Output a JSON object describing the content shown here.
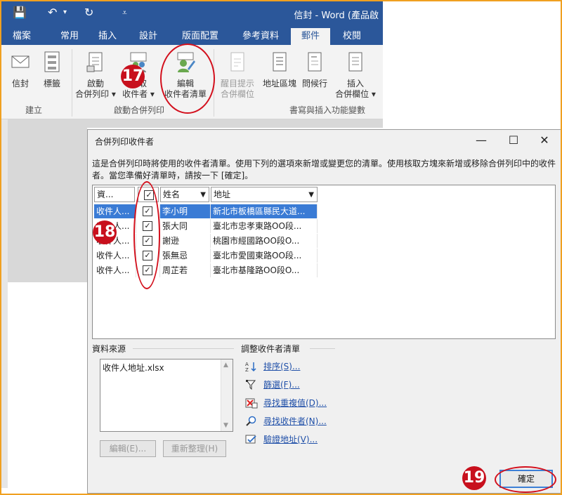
{
  "app": {
    "title": "信封 - Word (產品啟",
    "quick_access": {
      "save": "💾",
      "undo": "↶",
      "redo": "↻",
      "customize": "⩡"
    },
    "tabs": [
      "檔案",
      "常用",
      "插入",
      "設計",
      "版面配置",
      "參考資料",
      "郵件",
      "校閱"
    ],
    "active_tab": "郵件"
  },
  "ribbon": {
    "create": {
      "envelope": "信封",
      "labels": "標籤",
      "group": "建立"
    },
    "start": {
      "start_merge": [
        "啟動",
        "合併列印 ▾"
      ],
      "select_recipients": [
        "選取",
        "收件者 ▾"
      ],
      "edit_recipients": [
        "編輯",
        "收件者清單"
      ],
      "group": "啟動合併列印"
    },
    "write": {
      "highlight_fields": [
        "醒目提示",
        "合併欄位"
      ],
      "address_block": "地址區塊",
      "greeting_line": "問候行",
      "insert_field": [
        "插入",
        "合併欄位 ▾"
      ],
      "group": "書寫與插入功能變數"
    }
  },
  "dialog": {
    "title": "合併列印收件者",
    "controls": {
      "minimize": "—",
      "maximize": "☐",
      "close": "✕"
    },
    "instructions": "這是合併列印時將使用的收件者清單。使用下列的選項來新增或變更您的清單。使用核取方塊來新增或移除合併列印中的收件者。當您準備好清單時，請按一下 [確定]。",
    "columns": {
      "source": "資...",
      "check": "✓",
      "name": "姓名",
      "address": "地址"
    },
    "rows": [
      {
        "source": "收件人...",
        "checked": "✓",
        "name": "李小明",
        "address": "新北市板橋區縣民大道..."
      },
      {
        "source": "收件人...",
        "checked": "✓",
        "name": "張大同",
        "address": "臺北市忠孝東路OO段..."
      },
      {
        "source": "收件人...",
        "checked": "✓",
        "name": "謝逊",
        "address": "桃園市經國路OO段O..."
      },
      {
        "source": "收件人...",
        "checked": "✓",
        "name": "張無忌",
        "address": "臺北市愛國東路OO段..."
      },
      {
        "source": "收件人...",
        "checked": "✓",
        "name": "周芷若",
        "address": "臺北市基隆路OO段O..."
      }
    ],
    "data_source": {
      "label": "資料來源",
      "file": "收件人地址.xlsx",
      "edit_button": "編輯(E)...",
      "refresh_button": "重新整理(H)"
    },
    "refine": {
      "label": "調整收件者清單",
      "links": [
        "排序(S)...",
        "篩選(F)...",
        "尋找重複值(D)...",
        "尋找收件者(N)...",
        "驗證地址(V)..."
      ]
    },
    "ok_button": "確定"
  },
  "annotations": {
    "step_edit": "17",
    "step_check": "18",
    "step_ok": "19"
  },
  "colors": {
    "word_blue": "#2b579a",
    "selection": "#3a7bd5",
    "marker_red": "#c8101d",
    "link": "#1f4fa8"
  }
}
